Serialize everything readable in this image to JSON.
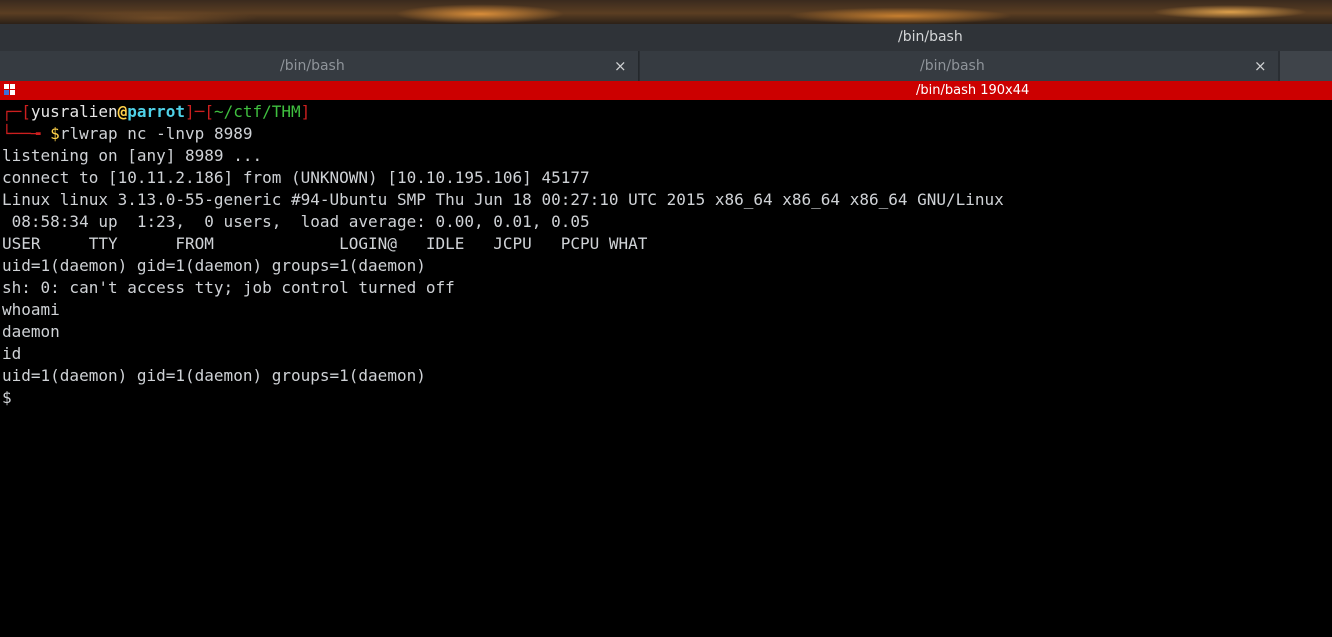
{
  "window": {
    "title": "/bin/bash"
  },
  "tabs": [
    {
      "label": "/bin/bash",
      "close": "×"
    },
    {
      "label": "/bin/bash",
      "close": "×"
    }
  ],
  "terminal_bar": {
    "title": "/bin/bash 190x44"
  },
  "prompt": {
    "open": "┌─[",
    "user": "yusralien",
    "at": "@",
    "host": "parrot",
    "sep": "]─[",
    "path": "~/ctf/THM",
    "close": "]",
    "corner": "└──╼ ",
    "dollar": "$",
    "command": "rlwrap nc -lnvp 8989"
  },
  "output": [
    "listening on [any] 8989 ...",
    "connect to [10.11.2.186] from (UNKNOWN) [10.10.195.106] 45177",
    "Linux linux 3.13.0-55-generic #94-Ubuntu SMP Thu Jun 18 00:27:10 UTC 2015 x86_64 x86_64 x86_64 GNU/Linux",
    " 08:58:34 up  1:23,  0 users,  load average: 0.00, 0.01, 0.05",
    "USER     TTY      FROM             LOGIN@   IDLE   JCPU   PCPU WHAT",
    "uid=1(daemon) gid=1(daemon) groups=1(daemon)",
    "sh: 0: can't access tty; job control turned off",
    "whoami",
    "daemon",
    "id",
    "uid=1(daemon) gid=1(daemon) groups=1(daemon)",
    "$"
  ],
  "colors": {
    "accent_red": "#cc0000",
    "terminal_bg": "#000000",
    "terminal_fg": "#cfd2d6",
    "host_cyan": "#4fd1e8",
    "path_green": "#3fbf3f",
    "at_yellow": "#ffd24a"
  }
}
